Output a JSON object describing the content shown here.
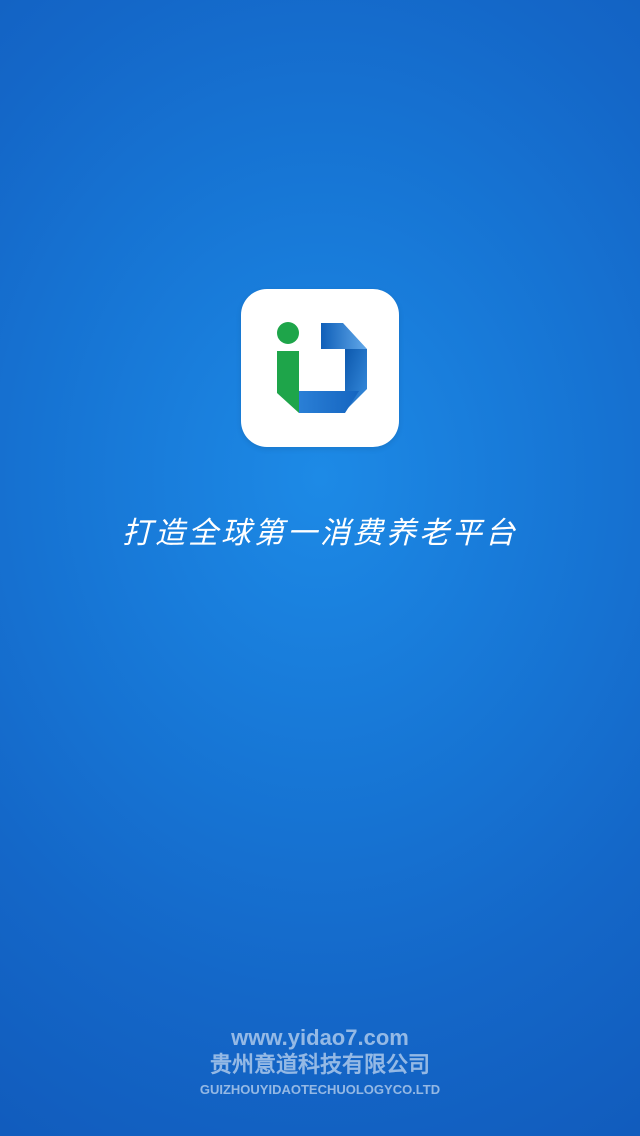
{
  "slogan": "打造全球第一消费养老平台",
  "footer": {
    "url": "www.yidao7.com",
    "company_cn": "贵州意道科技有限公司",
    "company_en": "GUIZHOUYIDAOTECHUOLOGYCO.LTD"
  },
  "icons": {
    "app_logo": "yidao-logo-icon"
  },
  "colors": {
    "background": "#1777d6",
    "logo_green": "#1ea54a",
    "logo_blue": "#1f73c9",
    "text": "#ffffff"
  }
}
